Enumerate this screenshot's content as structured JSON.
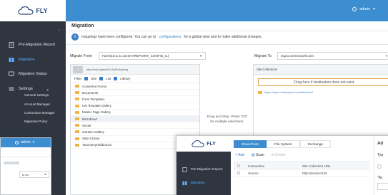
{
  "brand": {
    "name": "FLY"
  },
  "header": {
    "user": "admin"
  },
  "sidebar": {
    "items": [
      {
        "label": "Pre-Migration Report"
      },
      {
        "label": "Migration"
      },
      {
        "label": "Migration Status"
      },
      {
        "label": "Settings"
      }
    ],
    "settings_sub": [
      "General Settings",
      "Account Manager",
      "Connection Manager",
      "Migration Policy"
    ]
  },
  "main": {
    "title": "Migration",
    "mapping_count": "0",
    "mapping_msg_pre": "mappings have been configured. You can go to",
    "mapping_link": "configurations",
    "mapping_msg_post": "for a global view and to make additional changes.",
    "migrate_from_label": "Migrate From",
    "migrate_from_value": "Farm(10.6.21.32:SHAREPOINT_CONFIG_IL)",
    "migrate_to_label": "Migrate To",
    "migrate_to_value": "ctqxo.onmicrosoft.com",
    "source_path": "http://win-4gnfm67u7p81/mylong",
    "filter_label": "Filter",
    "filter_site": "Site",
    "filter_list": "List",
    "filter_library": "Library",
    "source_items": [
      "Converted Forms",
      "Documents",
      "Form Templates",
      "List Template Gallery",
      "Master Page Gallery",
      "MicroFeed",
      "Social",
      "Solution Gallery",
      "Style Library",
      "TaxonomyHiddenList"
    ],
    "drag_hint": "Drag and drop. Press 'Ctrl' for multiple selections.",
    "dest_header": "Site Collections",
    "drop_zone": "Drag here if destination does not exist.",
    "dest_item": "https://ctqxo.sharepoint.com/sites/crs2"
  },
  "overlay_left": {
    "user": "admin",
    "value": "to do"
  },
  "overlay_right": {
    "tabs": [
      "SharePoint",
      "File System",
      "Exchange"
    ],
    "toolbar": {
      "add": "Add",
      "scan": "Scan",
      "delete": "Delete"
    },
    "table": {
      "headers": [
        "Connection",
        "Site Collection URL"
      ],
      "rows": [
        [
          "Source",
          "http://product133"
        ]
      ]
    },
    "nav": [
      "Pre-Migration Report",
      "Migration"
    ],
    "right_title": "Ad",
    "right_line1": "Typ",
    "right_line2": "\"Ac"
  }
}
